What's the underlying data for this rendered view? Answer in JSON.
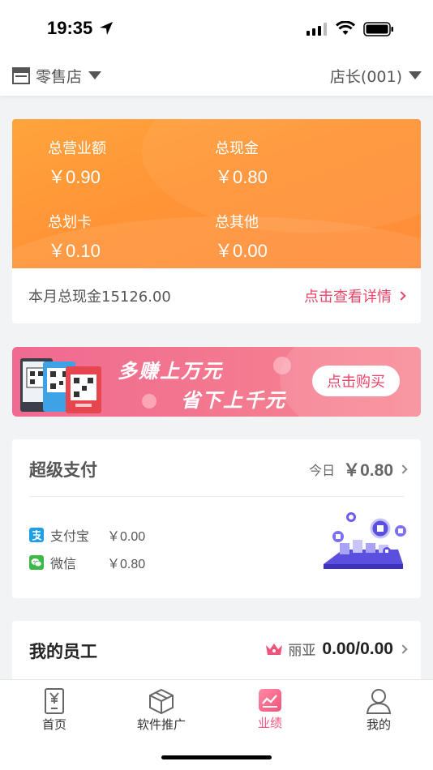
{
  "status_bar": {
    "time": "19:35"
  },
  "top_nav": {
    "store_label": "零售店",
    "manager_label": "店长(001)"
  },
  "revenue": {
    "stats": [
      {
        "title": "总营业额",
        "value": "￥0.90"
      },
      {
        "title": "总现金",
        "value": "￥0.80"
      },
      {
        "title": "总划卡",
        "value": "￥0.10"
      },
      {
        "title": "总其他",
        "value": "￥0.00"
      }
    ],
    "month_cash": "本月总现金15126.00",
    "detail_link": "点击查看详情"
  },
  "promo": {
    "line1": "多赚上万元",
    "line2": "省下上千元",
    "buy_button": "点击购买"
  },
  "super_pay": {
    "title": "超级支付",
    "today_label": "今日",
    "today_value": "￥0.80",
    "methods": [
      {
        "name": "支付宝",
        "amount": "￥0.00",
        "icon": "alipay-icon"
      },
      {
        "name": "微信",
        "amount": "￥0.80",
        "icon": "wechat-icon"
      }
    ]
  },
  "employees": {
    "title": "我的员工",
    "top_employee": "丽亚",
    "value": "0.00/0.00"
  },
  "tab_bar": {
    "tabs": [
      {
        "label": "首页",
        "icon": "home-yen-icon"
      },
      {
        "label": "软件推广",
        "icon": "box-icon"
      },
      {
        "label": "业绩",
        "icon": "chart-icon",
        "active": true
      },
      {
        "label": "我的",
        "icon": "user-icon"
      }
    ]
  },
  "colors": {
    "accent": "#f2537a",
    "orange": "#ff9437",
    "link_red": "#e9446a"
  }
}
